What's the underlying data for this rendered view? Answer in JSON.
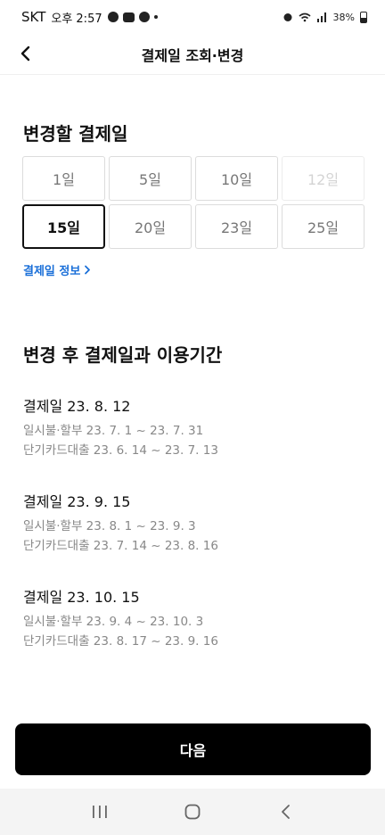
{
  "status_bar": {
    "carrier": "SKT",
    "time": "오후 2:57",
    "battery": "38%"
  },
  "header": {
    "title": "결제일 조회·변경"
  },
  "change_section": {
    "title": "변경할 결제일",
    "days": [
      {
        "label": "1일",
        "state": "normal"
      },
      {
        "label": "5일",
        "state": "normal"
      },
      {
        "label": "10일",
        "state": "normal"
      },
      {
        "label": "12일",
        "state": "disabled"
      },
      {
        "label": "15일",
        "state": "selected"
      },
      {
        "label": "20일",
        "state": "normal"
      },
      {
        "label": "23일",
        "state": "normal"
      },
      {
        "label": "25일",
        "state": "normal"
      }
    ],
    "info_link": "결제일 정보"
  },
  "periods_section": {
    "title": "변경 후 결제일과 이용기간",
    "periods": [
      {
        "date": "결제일 23. 8. 12",
        "lumpsum": "일시불·할부 23. 7. 1 ~ 23. 7. 31",
        "shortloan": "단기카드대출 23. 6. 14 ~ 23. 7. 13"
      },
      {
        "date": "결제일 23. 9. 15",
        "lumpsum": "일시불·할부 23. 8. 1 ~ 23. 9. 3",
        "shortloan": "단기카드대출 23. 7. 14 ~ 23. 8. 16"
      },
      {
        "date": "결제일 23. 10. 15",
        "lumpsum": "일시불·할부 23. 9. 4 ~ 23. 10. 3",
        "shortloan": "단기카드대출 23. 8. 17 ~ 23. 9. 16"
      }
    ]
  },
  "next_button": {
    "label": "다음"
  }
}
